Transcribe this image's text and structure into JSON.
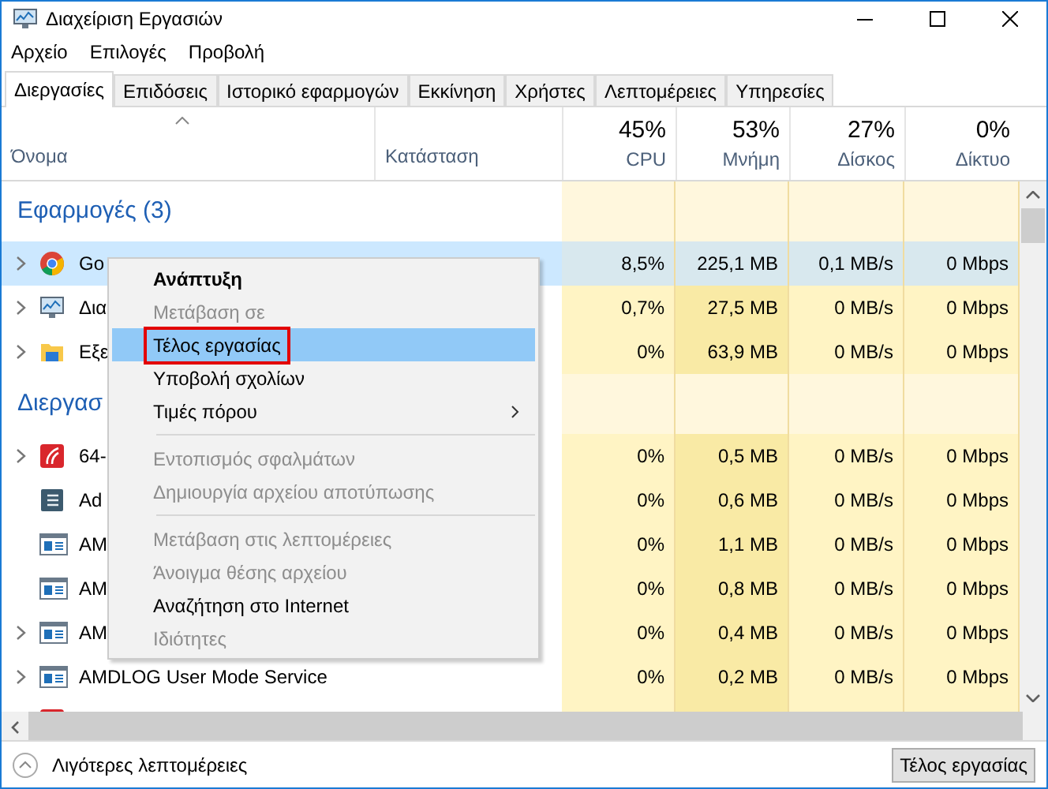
{
  "window": {
    "title": "Διαχείριση Εργασιών"
  },
  "menu": [
    "Αρχείο",
    "Επιλογές",
    "Προβολή"
  ],
  "tabs": [
    {
      "label": "Διεργασίες",
      "selected": true
    },
    {
      "label": "Επιδόσεις",
      "selected": false
    },
    {
      "label": "Ιστορικό εφαρμογών",
      "selected": false
    },
    {
      "label": "Εκκίνηση",
      "selected": false
    },
    {
      "label": "Χρήστες",
      "selected": false
    },
    {
      "label": "Λεπτομέρειες",
      "selected": false
    },
    {
      "label": "Υπηρεσίες",
      "selected": false
    }
  ],
  "columns": [
    {
      "label": "Όνομα"
    },
    {
      "label": "Κατάσταση"
    },
    {
      "label": "CPU",
      "total": "45%"
    },
    {
      "label": "Μνήμη",
      "total": "53%"
    },
    {
      "label": "Δίσκος",
      "total": "27%"
    },
    {
      "label": "Δίκτυο",
      "total": "0%"
    }
  ],
  "groups": [
    {
      "title": "Εφαρμογές (3)",
      "rows": [
        {
          "name": "Go",
          "kind": "browser",
          "expandable": true,
          "selected": true,
          "cpu": "8,5%",
          "memory": "225,1 MB",
          "disk": "0,1 MB/s",
          "network": "0 Mbps"
        },
        {
          "name": "Δια",
          "kind": "monitor",
          "expandable": true,
          "selected": false,
          "cpu": "0,7%",
          "memory": "27,5 MB",
          "disk": "0 MB/s",
          "network": "0 Mbps"
        },
        {
          "name": "Εξε",
          "kind": "folder",
          "expandable": true,
          "selected": false,
          "cpu": "0%",
          "memory": "63,9 MB",
          "disk": "0 MB/s",
          "network": "0 Mbps"
        }
      ]
    },
    {
      "title": "Διεργασ",
      "rows": [
        {
          "name": "64-",
          "kind": "red-app",
          "expandable": true,
          "selected": false,
          "cpu": "0%",
          "memory": "0,5 MB",
          "disk": "0 MB/s",
          "network": "0 Mbps"
        },
        {
          "name": "Ad",
          "kind": "document",
          "expandable": false,
          "selected": false,
          "cpu": "0%",
          "memory": "0,6 MB",
          "disk": "0 MB/s",
          "network": "0 Mbps"
        },
        {
          "name": "AM",
          "kind": "window",
          "expandable": false,
          "selected": false,
          "cpu": "0%",
          "memory": "1,1 MB",
          "disk": "0 MB/s",
          "network": "0 Mbps"
        },
        {
          "name": "AM",
          "kind": "window",
          "expandable": false,
          "selected": false,
          "cpu": "0%",
          "memory": "0,8 MB",
          "disk": "0 MB/s",
          "network": "0 Mbps"
        },
        {
          "name": "AM",
          "kind": "window",
          "expandable": true,
          "selected": false,
          "cpu": "0%",
          "memory": "0,4 MB",
          "disk": "0 MB/s",
          "network": "0 Mbps"
        },
        {
          "name": "AMDLOG User Mode Service",
          "kind": "window",
          "expandable": true,
          "selected": false,
          "cpu": "0%",
          "memory": "0,2 MB",
          "disk": "0 MB/s",
          "network": "0 Mbps"
        },
        {
          "kind": "red-app",
          "selected": false
        }
      ]
    }
  ],
  "context_menu": [
    {
      "kind": "item",
      "label": "Ανάπτυξη",
      "bold": true,
      "disabled": false,
      "selected": false,
      "outlined": false,
      "submenu": false
    },
    {
      "kind": "item",
      "label": "Μετάβαση σε",
      "bold": false,
      "disabled": true,
      "selected": false,
      "outlined": false,
      "submenu": false
    },
    {
      "kind": "item",
      "label": "Τέλος εργασίας",
      "bold": false,
      "disabled": false,
      "selected": true,
      "outlined": true,
      "submenu": false
    },
    {
      "kind": "item",
      "label": "Υποβολή σχολίων",
      "bold": false,
      "disabled": false,
      "selected": false,
      "outlined": false,
      "submenu": false
    },
    {
      "kind": "item",
      "label": "Τιμές πόρου",
      "bold": false,
      "disabled": false,
      "selected": false,
      "outlined": false,
      "submenu": true
    },
    {
      "kind": "separator"
    },
    {
      "kind": "item",
      "label": "Εντοπισμός σφαλμάτων",
      "bold": false,
      "disabled": true,
      "selected": false,
      "outlined": false,
      "submenu": false
    },
    {
      "kind": "item",
      "label": "Δημιουργία αρχείου αποτύπωσης",
      "bold": false,
      "disabled": true,
      "selected": false,
      "outlined": false,
      "submenu": false
    },
    {
      "kind": "separator"
    },
    {
      "kind": "item",
      "label": "Μετάβαση στις λεπτομέρειες",
      "bold": false,
      "disabled": true,
      "selected": false,
      "outlined": false,
      "submenu": false
    },
    {
      "kind": "item",
      "label": "Άνοιγμα θέσης αρχείου",
      "bold": false,
      "disabled": true,
      "selected": false,
      "outlined": false,
      "submenu": false
    },
    {
      "kind": "item",
      "label": "Αναζήτηση στο Internet",
      "bold": false,
      "disabled": false,
      "selected": false,
      "outlined": false,
      "submenu": false
    },
    {
      "kind": "item",
      "label": "Ιδιότητες",
      "bold": false,
      "disabled": true,
      "selected": false,
      "outlined": false,
      "submenu": false
    }
  ],
  "footer": {
    "details_link": "Λιγότερες λεπτομέρειες",
    "end_task_button": "Τέλος εργασίας"
  }
}
